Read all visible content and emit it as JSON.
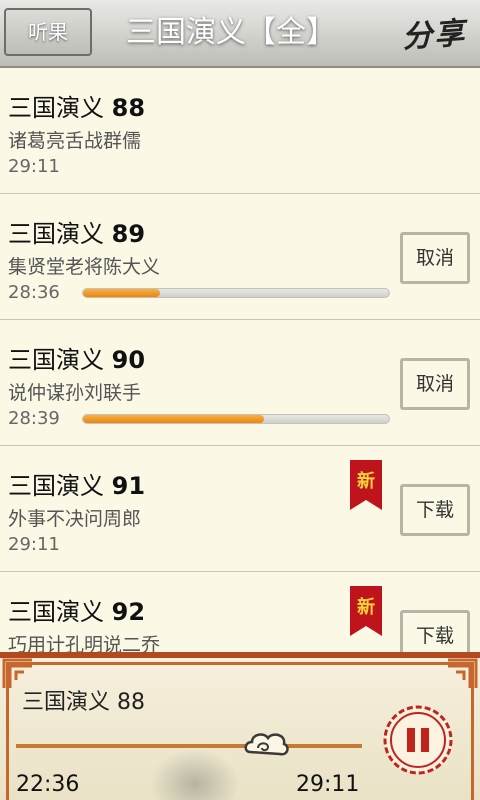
{
  "header": {
    "back_label": "听果",
    "title": "三国演义【全】",
    "share_label": "分享"
  },
  "episodes": [
    {
      "title": "三国演义",
      "number": "88",
      "subtitle": "诸葛亮舌战群儒",
      "duration": "29:11",
      "progress": null,
      "action": null,
      "is_new": false
    },
    {
      "title": "三国演义",
      "number": "89",
      "subtitle": "集贤堂老将陈大义",
      "duration": "28:36",
      "progress": 0.25,
      "action": "取消",
      "is_new": false
    },
    {
      "title": "三国演义",
      "number": "90",
      "subtitle": "说仲谋孙刘联手",
      "duration": "28:39",
      "progress": 0.59,
      "action": "取消",
      "is_new": false
    },
    {
      "title": "三国演义",
      "number": "91",
      "subtitle": "外事不决问周郎",
      "duration": "29:11",
      "progress": null,
      "action": "下载",
      "is_new": true,
      "badge": "新"
    },
    {
      "title": "三国演义",
      "number": "92",
      "subtitle": "巧用计孔明说二乔",
      "duration": "",
      "progress": null,
      "action": "下载",
      "is_new": true,
      "badge": "新"
    }
  ],
  "player": {
    "title": "三国演义 88",
    "current_time": "22:36",
    "total_time": "29:11",
    "seek_fraction": 0.77
  },
  "colors": {
    "progress_fill": "#e9860c",
    "badge_red": "#c0141c",
    "player_border": "#b14a1e"
  }
}
